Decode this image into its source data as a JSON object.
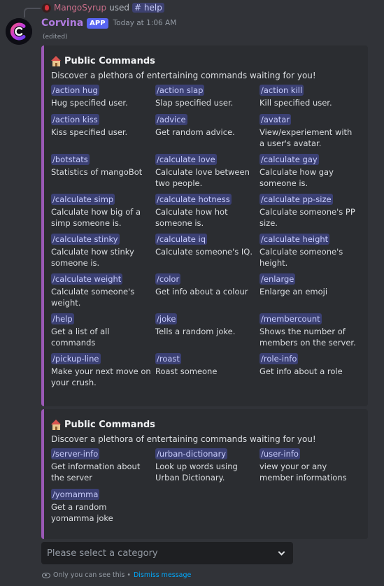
{
  "reply": {
    "user": "MangoSyrup",
    "used_text": "used",
    "command": "help",
    "command_prefix": "#"
  },
  "message": {
    "author": "Corvina",
    "tag": "APP",
    "timestamp": "Today at 1:06 AM",
    "edited": "(edited)"
  },
  "embeds": [
    {
      "title": "Public Commands",
      "description": "Discover a plethora of entertaining commands waiting for you!",
      "fields": [
        {
          "name": "/action hug",
          "value": "Hug specified user."
        },
        {
          "name": "/action slap",
          "value": "Slap specified user."
        },
        {
          "name": "/action kill",
          "value": "Kill specified user."
        },
        {
          "name": "/action kiss",
          "value": "Kiss specified user."
        },
        {
          "name": "/advice",
          "value": "Get random advice."
        },
        {
          "name": "/avatar",
          "value": "View/experiement with a user's avatar."
        },
        {
          "name": "/botstats",
          "value": "Statistics of mangoBot"
        },
        {
          "name": "/calculate love",
          "value": "Calculate love between two people."
        },
        {
          "name": "/calculate gay",
          "value": "Calculate how gay someone is."
        },
        {
          "name": "/calculate simp",
          "value": "Calculate how big of a simp someone is."
        },
        {
          "name": "/calculate hotness",
          "value": "Calculate how hot someone is."
        },
        {
          "name": "/calculate pp-size",
          "value": "Calculate someone's PP size."
        },
        {
          "name": "/calculate stinky",
          "value": "Calculate how stinky someone is."
        },
        {
          "name": "/calculate iq",
          "value": "Calculate someone's IQ."
        },
        {
          "name": "/calculate height",
          "value": "Calculate someone's height."
        },
        {
          "name": "/calculate weight",
          "value": "Calculate someone's weight."
        },
        {
          "name": "/color",
          "value": "Get info about a colour"
        },
        {
          "name": "/enlarge",
          "value": "Enlarge an emoji"
        },
        {
          "name": "/help",
          "value": "Get a list of all commands"
        },
        {
          "name": "/joke",
          "value": "Tells a random joke."
        },
        {
          "name": "/membercount",
          "value": "Shows the number of members on the server."
        },
        {
          "name": "/pickup-line",
          "value": "Make your next move on your crush."
        },
        {
          "name": "/roast",
          "value": "Roast someone"
        },
        {
          "name": "/role-info",
          "value": "Get info about a role"
        }
      ]
    },
    {
      "title": "Public Commands",
      "description": "Discover a plethora of entertaining commands waiting for you!",
      "fields": [
        {
          "name": "/server-info",
          "value": "Get information about the server"
        },
        {
          "name": "/urban-dictionary",
          "value": "Look up words using Urban Dictionary."
        },
        {
          "name": "/user-info",
          "value": "view your or any member informations"
        },
        {
          "name": "/yomamma",
          "value": "Get a random yomamma joke"
        }
      ]
    }
  ],
  "select": {
    "placeholder": "Please select a category"
  },
  "footer": {
    "notice": "Only you can see this •",
    "dismiss": "Dismiss message"
  },
  "colors": {
    "embed_accent": "#9b59b6",
    "author": "#b17ce0",
    "app_tag": "#5865f2",
    "link": "#00a8fc"
  }
}
